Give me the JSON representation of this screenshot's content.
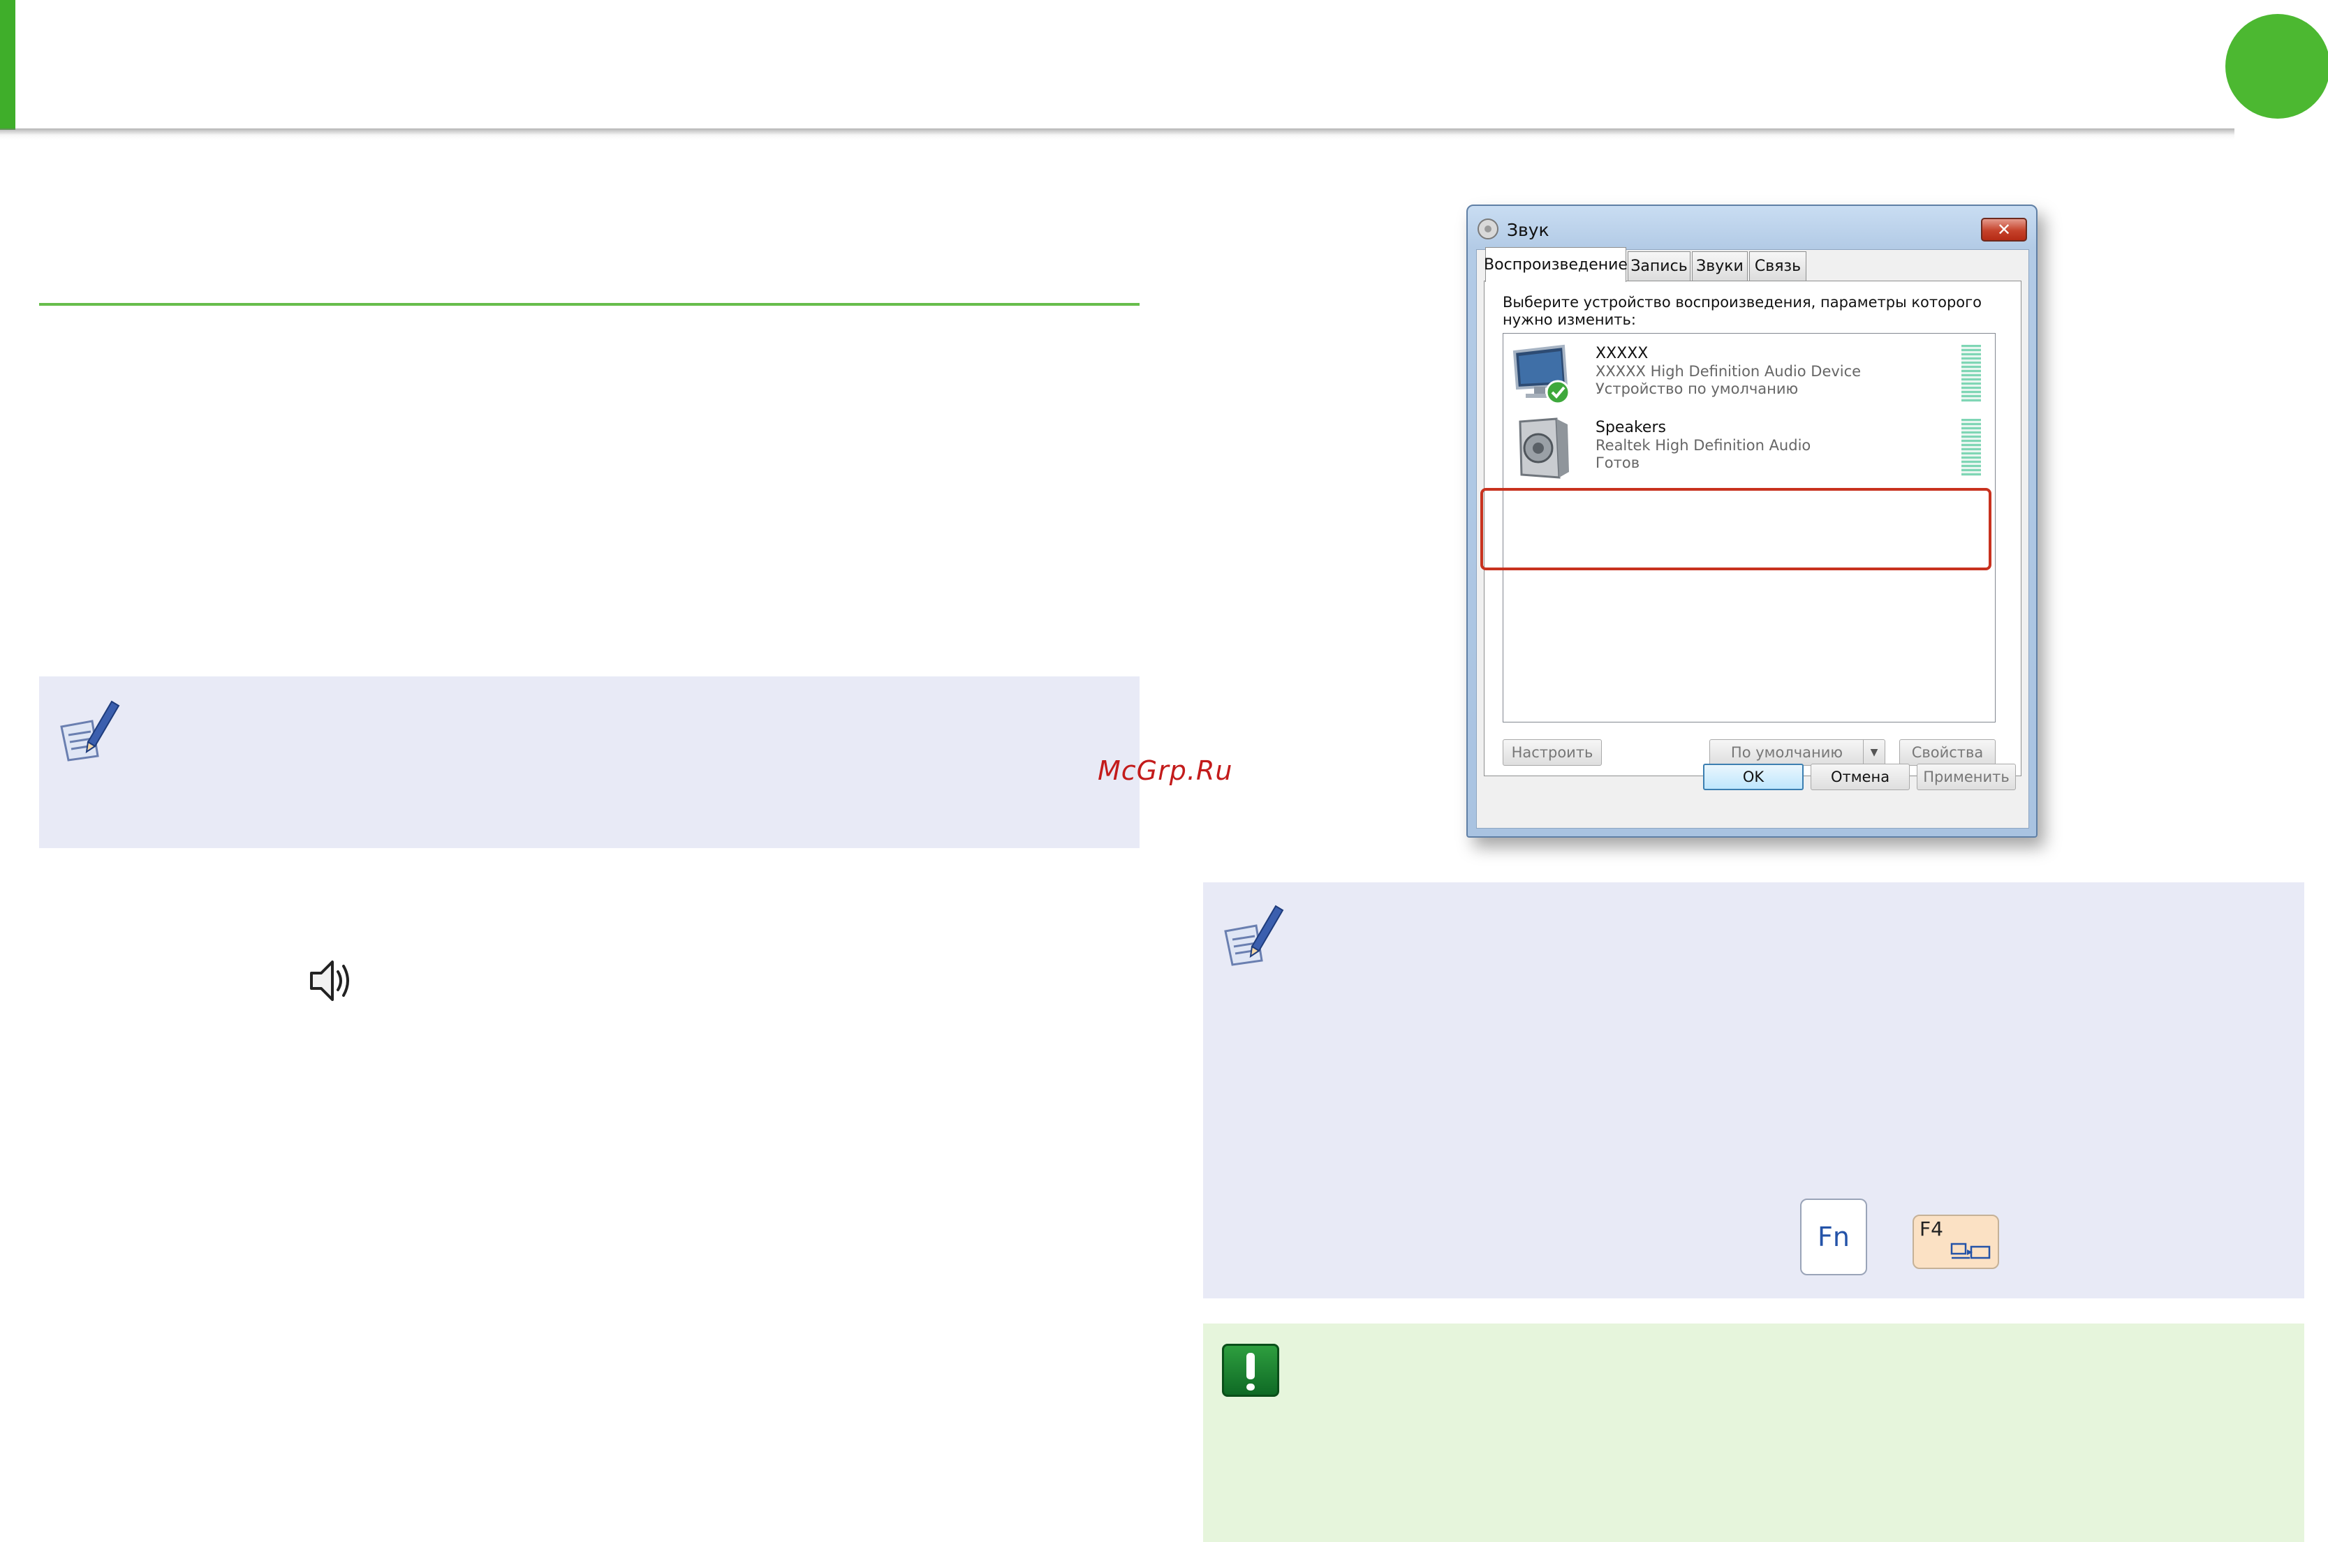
{
  "watermark": "McGrp.Ru",
  "dialog": {
    "title": "Звук",
    "close_symbol": "✕",
    "tabs": [
      {
        "label": "Воспроизведение",
        "active": true
      },
      {
        "label": "Запись",
        "active": false
      },
      {
        "label": "Звуки",
        "active": false
      },
      {
        "label": "Связь",
        "active": false
      }
    ],
    "description": "Выберите устройство воспроизведения, параметры которого нужно изменить:",
    "devices": [
      {
        "name": "XXXXX",
        "subtitle": "XXXXX High Definition Audio Device",
        "status": "Устройство по умолчанию",
        "icon": "monitor-icon",
        "is_default": true,
        "highlighted": true
      },
      {
        "name": "Speakers",
        "subtitle": "Realtek High Definition Audio",
        "status": "Готов",
        "icon": "speaker-device-icon",
        "is_default": false,
        "highlighted": false
      }
    ],
    "buttons": {
      "configure": "Настроить",
      "set_default": "По умолчанию",
      "properties": "Свойства",
      "ok": "OK",
      "cancel": "Отмена",
      "apply": "Применить"
    }
  },
  "keys": {
    "fn": "Fn",
    "f4": "F4"
  },
  "colors": {
    "accent_green": "#4cb831",
    "note_bg": "#e8eaf6",
    "caution_bg": "#e6f5dc",
    "highlight_red": "#c8321f"
  }
}
